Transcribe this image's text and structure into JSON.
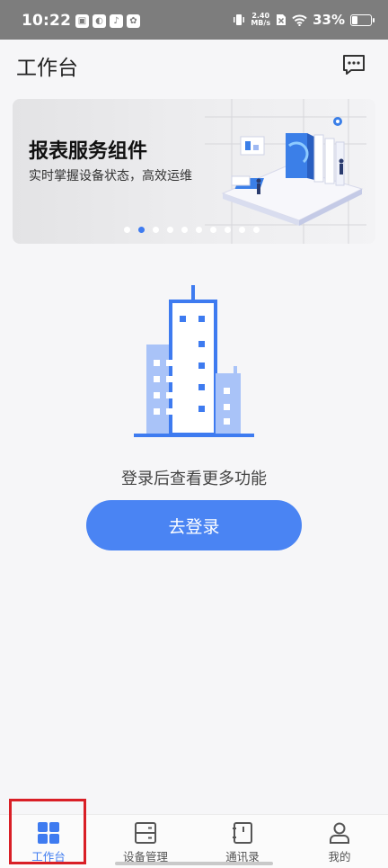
{
  "status_bar": {
    "time": "10:22",
    "net_speed_value": "2.40",
    "net_speed_unit": "MB/s",
    "battery": "33%"
  },
  "header": {
    "title": "工作台"
  },
  "banner": {
    "title": "报表服务组件",
    "subtitle": "实时掌握设备状态，高效运维",
    "dot_count": 10,
    "active_dot": 1
  },
  "empty_state": {
    "hint": "登录后查看更多功能",
    "login_button": "去登录"
  },
  "tabs": [
    {
      "label": "工作台",
      "icon": "grid-icon",
      "active": true
    },
    {
      "label": "设备管理",
      "icon": "server-icon",
      "active": false
    },
    {
      "label": "通讯录",
      "icon": "contacts-book-icon",
      "active": false
    },
    {
      "label": "我的",
      "icon": "person-icon",
      "active": false
    }
  ],
  "colors": {
    "accent": "#3e7bf0",
    "button": "#4a84f3",
    "highlight": "#d91f26"
  }
}
